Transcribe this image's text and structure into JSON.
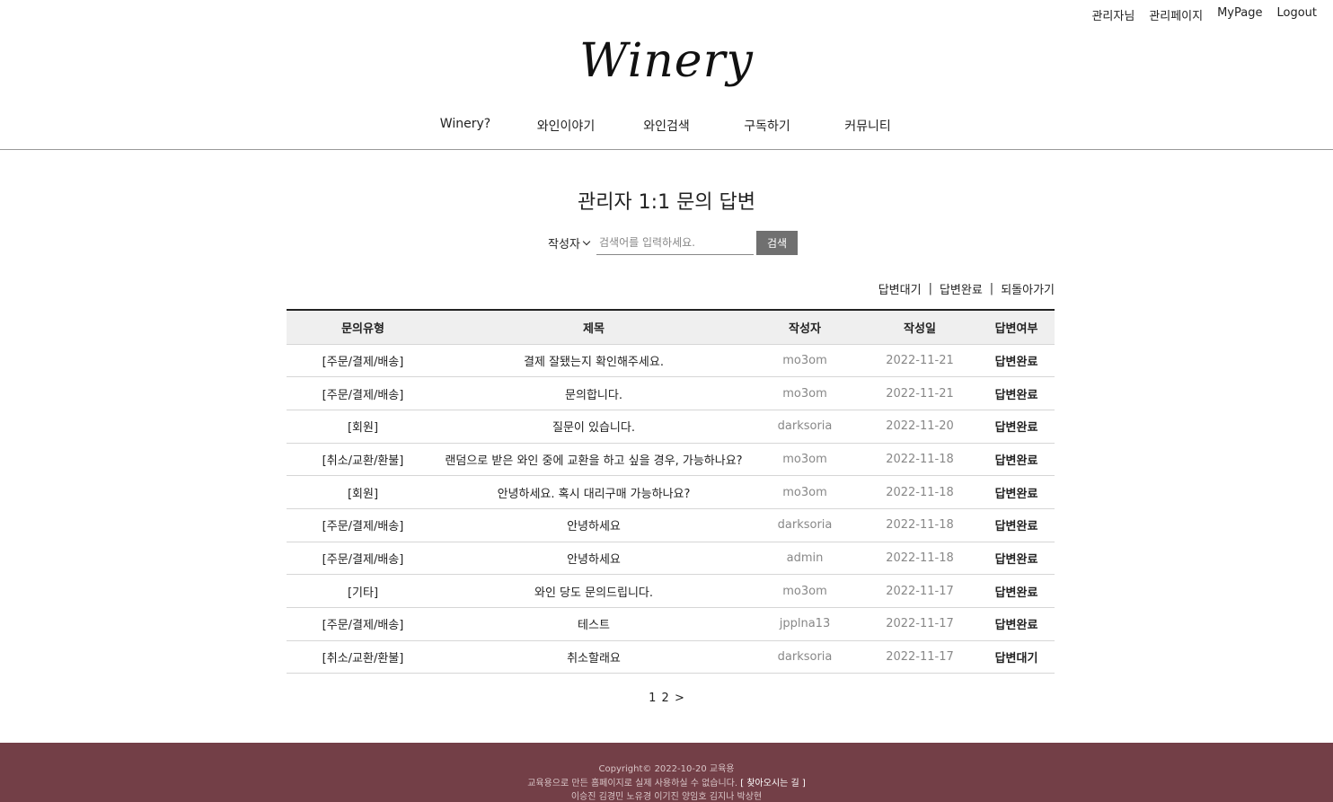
{
  "top_util": [
    "관리자님",
    "관리페이지",
    "MyPage",
    "Logout"
  ],
  "logo": "Winery",
  "gnb": [
    "Winery?",
    "와인이야기",
    "와인검색",
    "구독하기",
    "커뮤니티"
  ],
  "page_title": "관리자 1:1 문의 답변",
  "search": {
    "select_value": "작성자",
    "placeholder": "검색어를 입력하세요.",
    "button": "검색"
  },
  "filters": {
    "waiting": "답변대기",
    "sep": "|",
    "done": "답변완료",
    "back": "되돌아가기"
  },
  "table": {
    "headers": [
      "문의유형",
      "제목",
      "작성자",
      "작성일",
      "답변여부"
    ],
    "rows": [
      [
        "[주문/결제/배송]",
        "결제 잘됐는지 확인해주세요.",
        "mo3om",
        "2022-11-21",
        "답변완료"
      ],
      [
        "[주문/결제/배송]",
        "문의합니다.",
        "mo3om",
        "2022-11-21",
        "답변완료"
      ],
      [
        "[회원]",
        "질문이 있습니다.",
        "darksoria",
        "2022-11-20",
        "답변완료"
      ],
      [
        "[취소/교환/환불]",
        "랜덤으로 받은 와인 중에 교환을 하고 싶을 경우, 가능하나요?",
        "mo3om",
        "2022-11-18",
        "답변완료"
      ],
      [
        "[회원]",
        "안녕하세요. 혹시 대리구매 가능하나요?",
        "mo3om",
        "2022-11-18",
        "답변완료"
      ],
      [
        "[주문/결제/배송]",
        "안녕하세요",
        "darksoria",
        "2022-11-18",
        "답변완료"
      ],
      [
        "[주문/결제/배송]",
        "안녕하세요",
        "admin",
        "2022-11-18",
        "답변완료"
      ],
      [
        "[기타]",
        "와인 당도 문의드립니다.",
        "mo3om",
        "2022-11-17",
        "답변완료"
      ],
      [
        "[주문/결제/배송]",
        "테스트",
        "jpplna13",
        "2022-11-17",
        "답변완료"
      ],
      [
        "[취소/교환/환불]",
        "취소할래요",
        "darksoria",
        "2022-11-17",
        "답변대기"
      ]
    ]
  },
  "pager": [
    "1",
    "2",
    ">"
  ],
  "footer": {
    "copyright": "Copyright© 2022-10-20 교육용",
    "notice": "교육용으로 만든 홈페이지로 실제 사용하실 수 없습니다.",
    "map_link": "[ 찾아오시는 길 ]",
    "members": "이승진 김경민 노유경 이기진 양임호 김지나 박상현"
  },
  "colors": {
    "footer_bg": "#733f47",
    "search_button_bg": "#707070",
    "table_header_bg": "#efefef"
  }
}
